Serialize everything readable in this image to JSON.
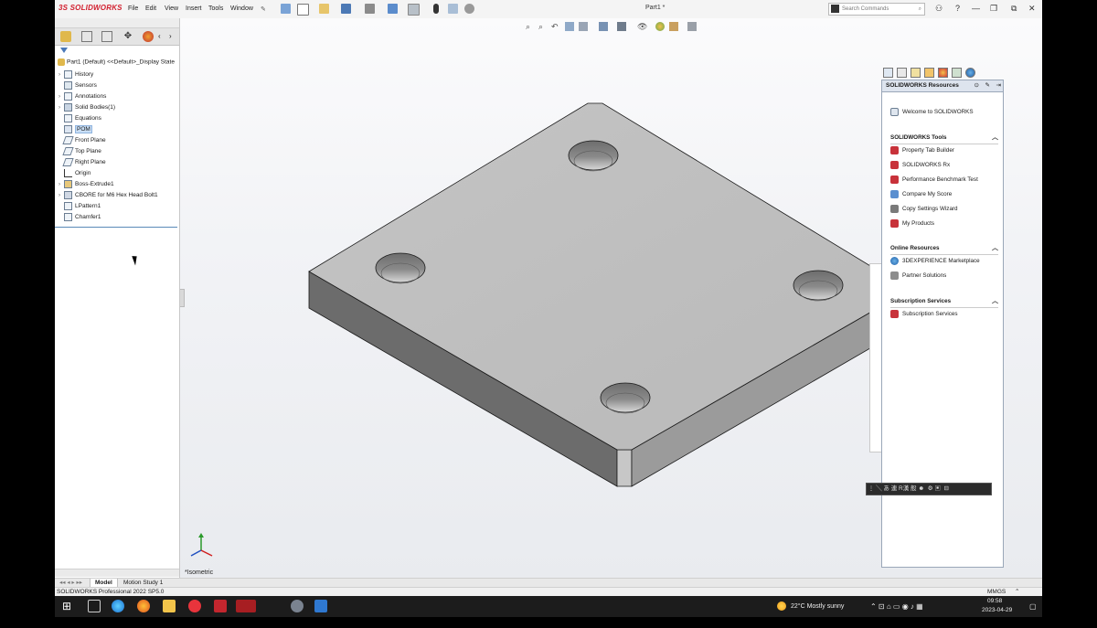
{
  "app": {
    "logo_text": "SOLIDWORKS",
    "document_title": "Part1 *",
    "menu": [
      "File",
      "Edit",
      "View",
      "Insert",
      "Tools",
      "Window"
    ],
    "search_placeholder": "Search Commands",
    "brand_color": "#d2202f"
  },
  "feature_tree": {
    "root_label": "Part1 (Default) <<Default>_Display State",
    "items": [
      {
        "label": "History",
        "icon": "history-icon",
        "expandable": true
      },
      {
        "label": "Sensors",
        "icon": "sensors-icon",
        "expandable": false
      },
      {
        "label": "Annotations",
        "icon": "annotations-icon",
        "expandable": true
      },
      {
        "label": "Solid Bodies(1)",
        "icon": "solid-bodies-icon",
        "expandable": true
      },
      {
        "label": "Equations",
        "icon": "equations-icon",
        "expandable": false
      },
      {
        "label": "POM",
        "icon": "material-icon",
        "expandable": false,
        "selected": true
      },
      {
        "label": "Front Plane",
        "icon": "plane-icon",
        "expandable": false
      },
      {
        "label": "Top Plane",
        "icon": "plane-icon",
        "expandable": false
      },
      {
        "label": "Right Plane",
        "icon": "plane-icon",
        "expandable": false
      },
      {
        "label": "Origin",
        "icon": "origin-icon",
        "expandable": false
      },
      {
        "label": "Boss-Extrude1",
        "icon": "extrude-icon",
        "expandable": true
      },
      {
        "label": "CBORE for M6 Hex Head Bolt1",
        "icon": "hole-wizard-icon",
        "expandable": true
      },
      {
        "label": "LPattern1",
        "icon": "linear-pattern-icon",
        "expandable": false
      },
      {
        "label": "Chamfer1",
        "icon": "chamfer-icon",
        "expandable": false
      }
    ]
  },
  "viewport": {
    "view_name": "*Isometric",
    "model_color": "#bdbdbd"
  },
  "resources_pane": {
    "title": "SOLIDWORKS Resources",
    "welcome": "Welcome to SOLIDWORKS",
    "sections": [
      {
        "title": "SOLIDWORKS Tools",
        "links": [
          "Property Tab Builder",
          "SOLIDWORKS Rx",
          "Performance Benchmark Test",
          "Compare My Score",
          "Copy Settings Wizard",
          "My Products"
        ]
      },
      {
        "title": "Online Resources",
        "links": [
          "3DEXPERIENCE Marketplace",
          "Partner Solutions"
        ]
      },
      {
        "title": "Subscription Services",
        "links": [
          "Subscription Services"
        ]
      }
    ]
  },
  "bottom_tabs": [
    "Model",
    "Motion Study 1"
  ],
  "status": {
    "product": "SOLIDWORKS Professional 2022 SP5.0",
    "units": "MMGS"
  },
  "taskbar": {
    "weather": "22°C  Mostly sunny",
    "time": "09:58",
    "date": "2023-04-29"
  }
}
